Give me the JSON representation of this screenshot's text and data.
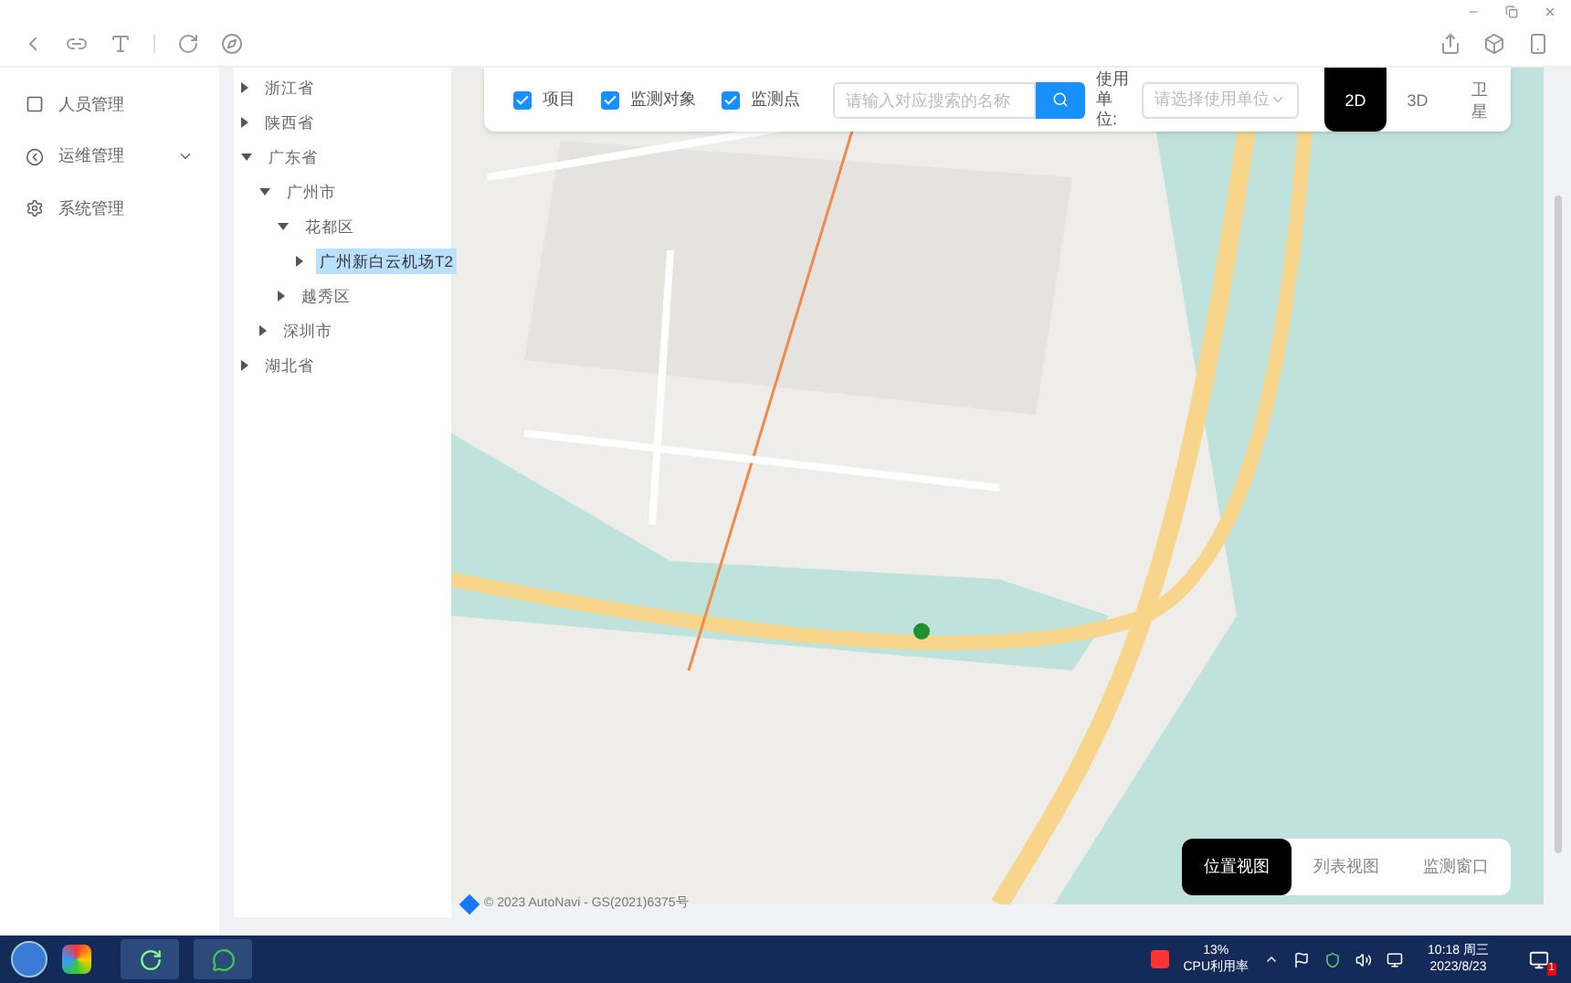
{
  "sidebar": {
    "items": [
      {
        "label": "人员管理",
        "expandable": false
      },
      {
        "label": "运维管理",
        "expandable": true
      },
      {
        "label": "系统管理",
        "expandable": false
      }
    ]
  },
  "tree": [
    {
      "label": "浙江省",
      "expanded": false,
      "selected": false
    },
    {
      "label": "陕西省",
      "expanded": false,
      "selected": false
    },
    {
      "label": "广东省",
      "expanded": true,
      "selected": false,
      "children": [
        {
          "label": "广州市",
          "expanded": true,
          "selected": false,
          "children": [
            {
              "label": "花都区",
              "expanded": true,
              "selected": false,
              "children": [
                {
                  "label": "广州新白云机场T2",
                  "expanded": false,
                  "selected": true
                }
              ]
            },
            {
              "label": "越秀区",
              "expanded": false,
              "selected": false
            }
          ]
        },
        {
          "label": "深圳市",
          "expanded": false,
          "selected": false
        }
      ]
    },
    {
      "label": "湖北省",
      "expanded": false,
      "selected": false
    }
  ],
  "filters": [
    {
      "label": "项目",
      "checked": true
    },
    {
      "label": "监测对象",
      "checked": true
    },
    {
      "label": "监测点",
      "checked": true
    }
  ],
  "search": {
    "placeholder": "请输入对应搜索的名称"
  },
  "unit_select": {
    "label": "使用单位:",
    "placeholder": "请选择使用单位"
  },
  "map_modes": [
    {
      "label": "2D",
      "selected": true
    },
    {
      "label": "3D",
      "selected": false
    },
    {
      "label": "卫星",
      "selected": false
    }
  ],
  "view_tabs": [
    {
      "label": "位置视图",
      "selected": true
    },
    {
      "label": "列表视图",
      "selected": false
    },
    {
      "label": "监测窗口",
      "selected": false
    }
  ],
  "map_attribution": "© 2023 AutoNavi - GS(2021)6375号",
  "taskbar": {
    "cpu_percent": "13%",
    "cpu_label": "CPU利用率",
    "time": "10:18 周三",
    "date": "2023/8/23",
    "notifications": "1"
  }
}
